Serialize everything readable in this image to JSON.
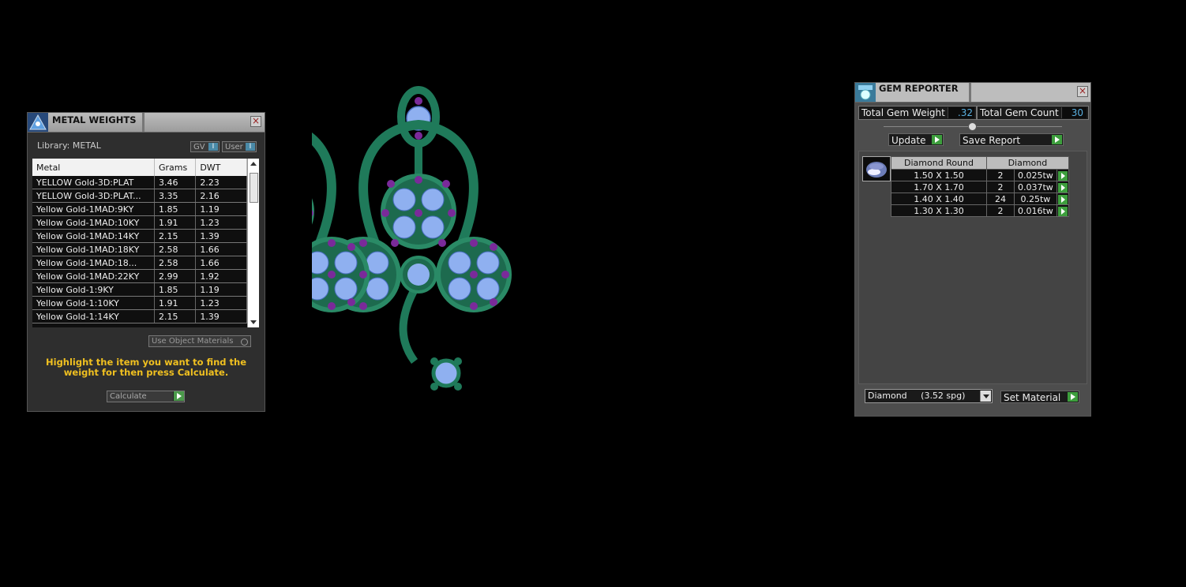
{
  "metal_weights": {
    "title": "METAL WEIGHTS",
    "library_label": "Library: METAL",
    "gv_btn": "GV",
    "user_btn": "User",
    "columns": [
      "Metal",
      "Grams",
      "DWT"
    ],
    "rows": [
      [
        "YELLOW Gold-3D:PLAT",
        "3.46",
        "2.23"
      ],
      [
        "YELLOW Gold-3D:PLAT...",
        "3.35",
        "2.16"
      ],
      [
        "Yellow Gold-1MAD:9KY",
        "1.85",
        "1.19"
      ],
      [
        "Yellow Gold-1MAD:10KY",
        "1.91",
        "1.23"
      ],
      [
        "Yellow Gold-1MAD:14KY",
        "2.15",
        "1.39"
      ],
      [
        "Yellow Gold-1MAD:18KY",
        "2.58",
        "1.66"
      ],
      [
        "Yellow Gold-1MAD:18...",
        "2.58",
        "1.66"
      ],
      [
        "Yellow Gold-1MAD:22KY",
        "2.99",
        "1.92"
      ],
      [
        "Yellow Gold-1:9KY",
        "1.85",
        "1.19"
      ],
      [
        "Yellow Gold-1:10KY",
        "1.91",
        "1.23"
      ],
      [
        "Yellow Gold-1:14KY",
        "2.15",
        "1.39"
      ]
    ],
    "use_object_materials": "Use Object Materials",
    "instruction": "Highlight the item you want to find the weight for then press Calculate.",
    "calculate_btn": "Calculate"
  },
  "gem_reporter": {
    "title": "GEM REPORTER",
    "total_weight_label": "Total Gem Weight",
    "total_weight_value": ".32",
    "total_count_label": "Total Gem Count",
    "total_count_value": "30",
    "update_btn": "Update",
    "save_report_btn": "Save Report",
    "table_headers": [
      "Diamond Round",
      "Diamond"
    ],
    "rows": [
      [
        "1.50 X 1.50",
        "2",
        "0.025tw"
      ],
      [
        "1.70 X 1.70",
        "2",
        "0.037tw"
      ],
      [
        "1.40 X 1.40",
        "24",
        "0.25tw"
      ],
      [
        "1.30 X 1.30",
        "2",
        "0.016tw"
      ]
    ],
    "material_select": "Diamond     (3.52 spg)",
    "set_material_btn": "Set Material"
  },
  "colors": {
    "metal": "#1f7a5a",
    "gem_blue": "#8fb0f0",
    "gem_purple": "#7a2a9a",
    "instruction_text": "#f0c020",
    "go_green": "#3d9e3d"
  }
}
